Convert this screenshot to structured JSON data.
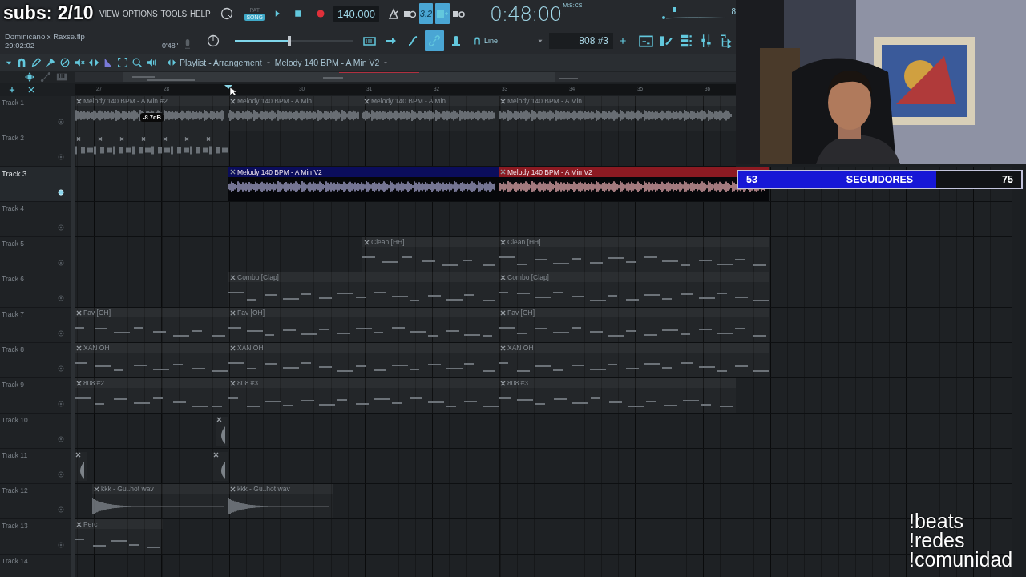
{
  "overlay": {
    "subs": "subs: 2/10",
    "goal": {
      "current": "53",
      "label": "SEGUIDORES",
      "target": "75",
      "level": 0.7
    },
    "commands": [
      "!beats",
      "!redes",
      "!comunidad"
    ]
  },
  "webcam": {
    "kind": "picture"
  },
  "menu": [
    "VIEW",
    "OPTIONS",
    "TOOLS",
    "HELP"
  ],
  "project": {
    "file": "Dominicano x Raxse.flp",
    "time": "29:02:02",
    "length": "0'48''"
  },
  "transport": {
    "modes": [
      {
        "label": "PAT",
        "selected": false
      },
      {
        "label": "SONG",
        "selected": true
      }
    ],
    "tempo": "140.000",
    "position": "0:48:00",
    "position_unit": "M:S:CS",
    "meter_value": "8",
    "volume": {
      "level": 0.46
    }
  },
  "toolbar": {
    "row1": [
      {
        "kind": "metronome",
        "selected": false
      },
      {
        "kind": "wait",
        "selected": false
      },
      {
        "kind": "countdown",
        "label": "3.2",
        "selected": true
      },
      {
        "kind": "step",
        "selected": true
      },
      {
        "kind": "loop",
        "selected": false
      }
    ],
    "row2": [
      {
        "kind": "typing",
        "selected": false
      },
      {
        "kind": "arrow",
        "selected": false
      },
      {
        "kind": "curve",
        "selected": false
      },
      {
        "kind": "link",
        "selected": true
      },
      {
        "kind": "bell",
        "selected": false
      }
    ],
    "snap": "Line",
    "pattern": "808 #3"
  },
  "playlist": {
    "title": "Playlist - Arrangement",
    "pattern": "Melody 140 BPM - A Min V2",
    "ruler": [
      "27",
      "28",
      "30",
      "31",
      "32",
      "33",
      "34",
      "35",
      "36"
    ],
    "tracks": [
      {
        "name": "Track 1",
        "selected": false,
        "clips": [
          {
            "kind": "audio",
            "label": "Melody 140 BPM - A Min #2",
            "volume": "-8.7dB"
          },
          {
            "kind": "audio",
            "label": "Melody 140 BPM - A Min"
          },
          {
            "kind": "audio",
            "label": "Melody 140 BPM - A Min"
          },
          {
            "kind": "audio",
            "label": "Melody 140 BPM - A Min"
          }
        ]
      },
      {
        "name": "Track 2",
        "selected": false,
        "clips": [
          {
            "kind": "slices"
          }
        ]
      },
      {
        "name": "Track 3",
        "selected": true,
        "clips": [
          {
            "kind": "audio",
            "label": "Melody 140 BPM - A Min V2",
            "color": "#0b0d5c"
          },
          {
            "kind": "audio",
            "label": "Melody 140 BPM - A Min V2",
            "color": "#8c1a22"
          }
        ]
      },
      {
        "name": "Track 4",
        "selected": false
      },
      {
        "name": "Track 5",
        "selected": false,
        "clips": [
          {
            "kind": "pattern",
            "label": "Clean [HH]"
          },
          {
            "kind": "pattern",
            "label": "Clean [HH]"
          }
        ]
      },
      {
        "name": "Track 6",
        "selected": false,
        "clips": [
          {
            "kind": "pattern",
            "label": "Combo [Clap]"
          },
          {
            "kind": "pattern",
            "label": "Combo [Clap]"
          }
        ]
      },
      {
        "name": "Track 7",
        "selected": false,
        "clips": [
          {
            "kind": "pattern",
            "label": "Fav [OH]"
          },
          {
            "kind": "pattern",
            "label": "Fav [OH]"
          },
          {
            "kind": "pattern",
            "label": "Fav [OH]"
          }
        ]
      },
      {
        "name": "Track 8",
        "selected": false,
        "clips": [
          {
            "kind": "pattern",
            "label": "XAN OH"
          },
          {
            "kind": "pattern",
            "label": "XAN OH"
          },
          {
            "kind": "pattern",
            "label": "XAN OH"
          }
        ]
      },
      {
        "name": "Track 9",
        "selected": false,
        "clips": [
          {
            "kind": "pattern",
            "label": "808 #2"
          },
          {
            "kind": "pattern",
            "label": "808 #3"
          },
          {
            "kind": "pattern",
            "label": "808 #3"
          }
        ]
      },
      {
        "name": "Track 10",
        "selected": false,
        "clips": [
          {
            "kind": "hit"
          }
        ]
      },
      {
        "name": "Track 11",
        "selected": false,
        "clips": [
          {
            "kind": "hit"
          },
          {
            "kind": "hit"
          }
        ]
      },
      {
        "name": "Track 12",
        "selected": false,
        "clips": [
          {
            "kind": "audio",
            "label": "kkk - Gu..hot wav"
          },
          {
            "kind": "audio",
            "label": "kkk - Gu..hot wav"
          }
        ]
      },
      {
        "name": "Track 13",
        "selected": false,
        "clips": [
          {
            "kind": "pattern",
            "label": "Perc"
          }
        ]
      },
      {
        "name": "Track 14",
        "selected": false
      }
    ]
  }
}
